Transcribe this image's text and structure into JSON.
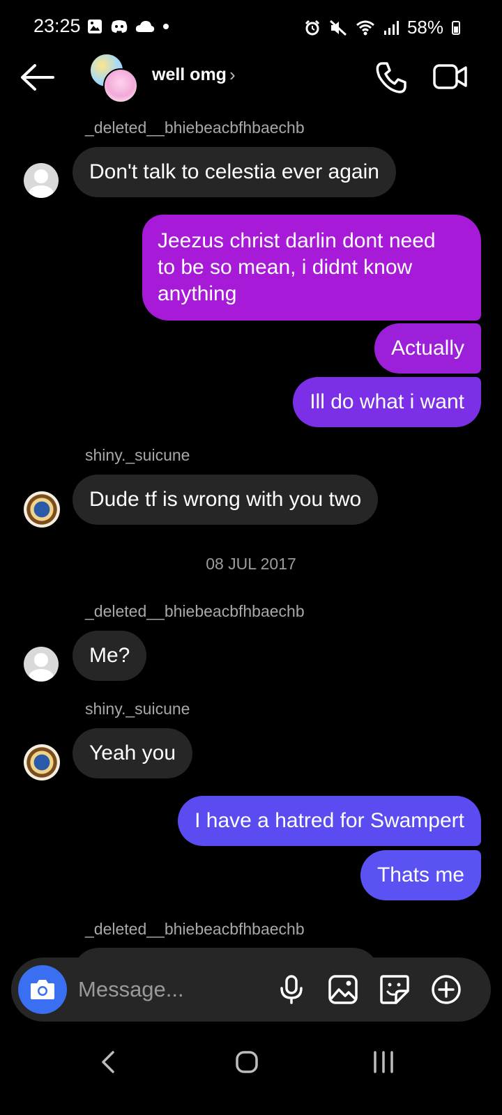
{
  "status_bar": {
    "time": "23:25",
    "battery": "58%",
    "left_icons": [
      "gallery-icon",
      "discord-icon",
      "cloud-icon",
      "dot-icon"
    ],
    "right_icons": [
      "alarm-icon",
      "mute-icon",
      "wifi-icon",
      "signal-icon",
      "battery-icon"
    ]
  },
  "header": {
    "title": "well omg",
    "title_chevron": "›"
  },
  "messages": [
    {
      "kind": "sender",
      "text": "_deleted__bhiebeacbfhbaechb"
    },
    {
      "kind": "in",
      "text": "Don't talk to celestia ever again",
      "avatar": "default"
    },
    {
      "kind": "out",
      "lines": [
        "Jeezus christ darlin dont need",
        "to be so mean, i didnt know",
        "anything"
      ]
    },
    {
      "kind": "out",
      "text": "Actually"
    },
    {
      "kind": "out",
      "text": "Ill do what i want"
    },
    {
      "kind": "sender",
      "text": "shiny._suicune"
    },
    {
      "kind": "in",
      "text": "Dude tf is wrong with you two",
      "avatar": "badge"
    },
    {
      "kind": "date",
      "text": "08 JUL 2017"
    },
    {
      "kind": "sender",
      "text": "_deleted__bhiebeacbfhbaechb"
    },
    {
      "kind": "in",
      "text": "Me?",
      "avatar": "default"
    },
    {
      "kind": "sender",
      "text": "shiny._suicune"
    },
    {
      "kind": "in",
      "text": "Yeah you",
      "avatar": "badge"
    },
    {
      "kind": "out",
      "text": "I have a hatred for Swampert"
    },
    {
      "kind": "out",
      "text": "Thats me"
    },
    {
      "kind": "sender",
      "text": "_deleted__bhiebeacbfhbaechb"
    }
  ],
  "composer": {
    "placeholder": "Message..."
  },
  "colors": {
    "background": "#000000",
    "incoming_bubble": "#262626",
    "outgoing_purple": "#a71bd8",
    "outgoing_violet": "#7b2fe6",
    "outgoing_indigo": "#5a4cf0",
    "camera_button": "#3a6ff2"
  }
}
